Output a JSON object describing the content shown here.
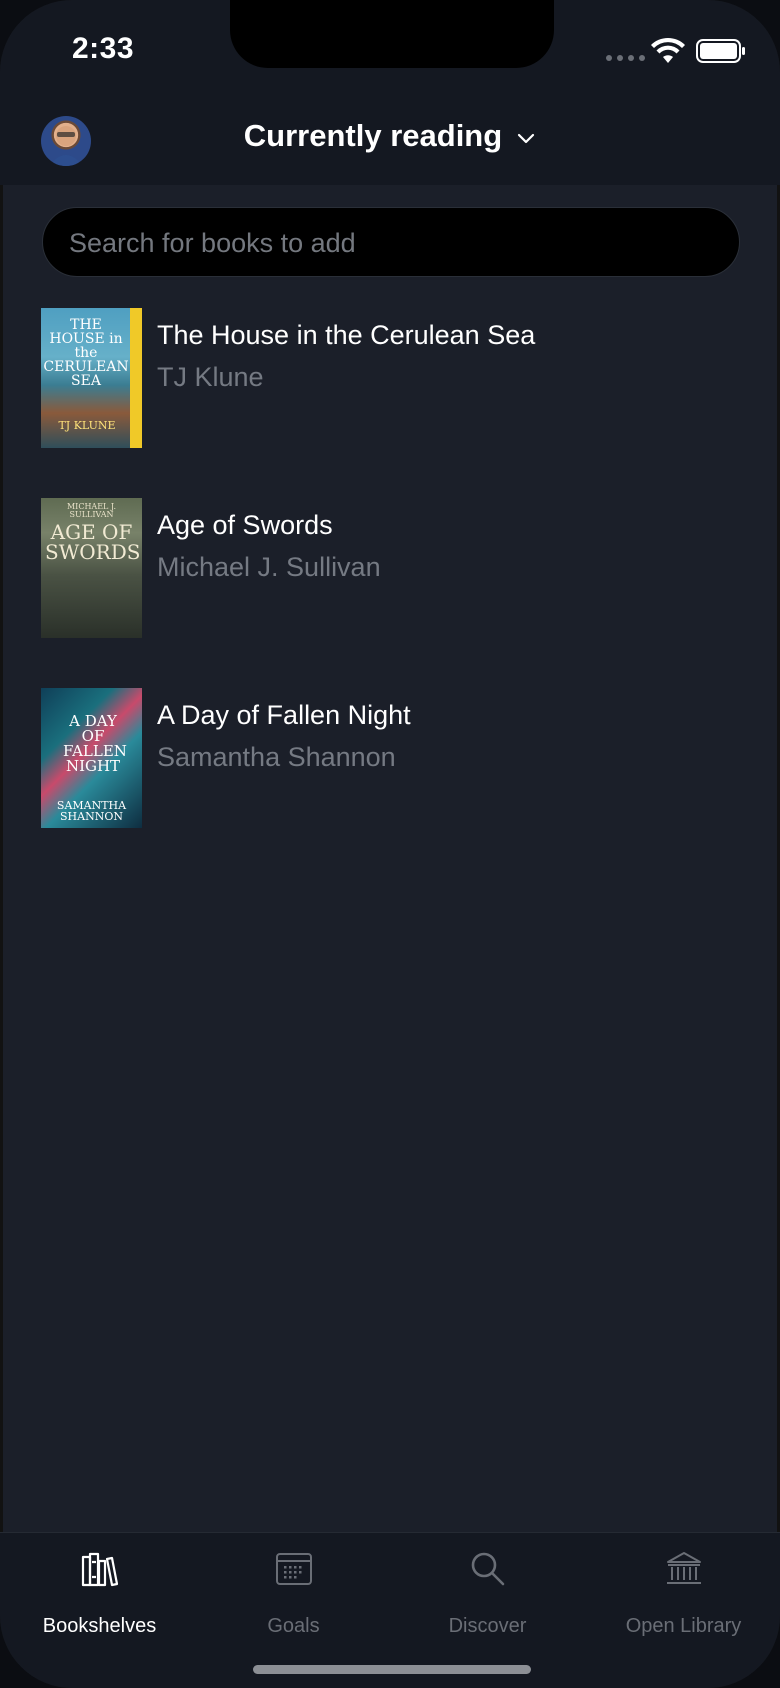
{
  "status_bar": {
    "time": "2:33"
  },
  "header": {
    "title": "Currently reading",
    "avatar_icon": "user-avatar"
  },
  "search": {
    "placeholder": "Search for books to add"
  },
  "books": [
    {
      "title": "The House in the Cerulean Sea",
      "author": "TJ Klune",
      "cover_text_top": "THE HOUSE in the CERULEAN SEA",
      "cover_text_bottom": "TJ KLUNE"
    },
    {
      "title": "Age of Swords",
      "author": "Michael J. Sullivan",
      "cover_text_top": "MICHAEL J. SULLIVAN",
      "cover_text_bottom": "AGE OF SWORDS"
    },
    {
      "title": "A Day of Fallen Night",
      "author": "Samantha Shannon",
      "cover_text_top": "A DAY OF FALLEN NIGHT",
      "cover_text_bottom": "SAMANTHA SHANNON"
    }
  ],
  "tabs": [
    {
      "label": "Bookshelves",
      "icon": "bookshelves-icon",
      "active": true
    },
    {
      "label": "Goals",
      "icon": "calendar-icon",
      "active": false
    },
    {
      "label": "Discover",
      "icon": "search-icon",
      "active": false
    },
    {
      "label": "Open Library",
      "icon": "library-icon",
      "active": false
    }
  ],
  "colors": {
    "background": "#1b1f29",
    "header_background": "#141821",
    "primary_text": "#ffffff",
    "secondary_text": "#757a83",
    "inactive_tab": "#6a6e76"
  }
}
